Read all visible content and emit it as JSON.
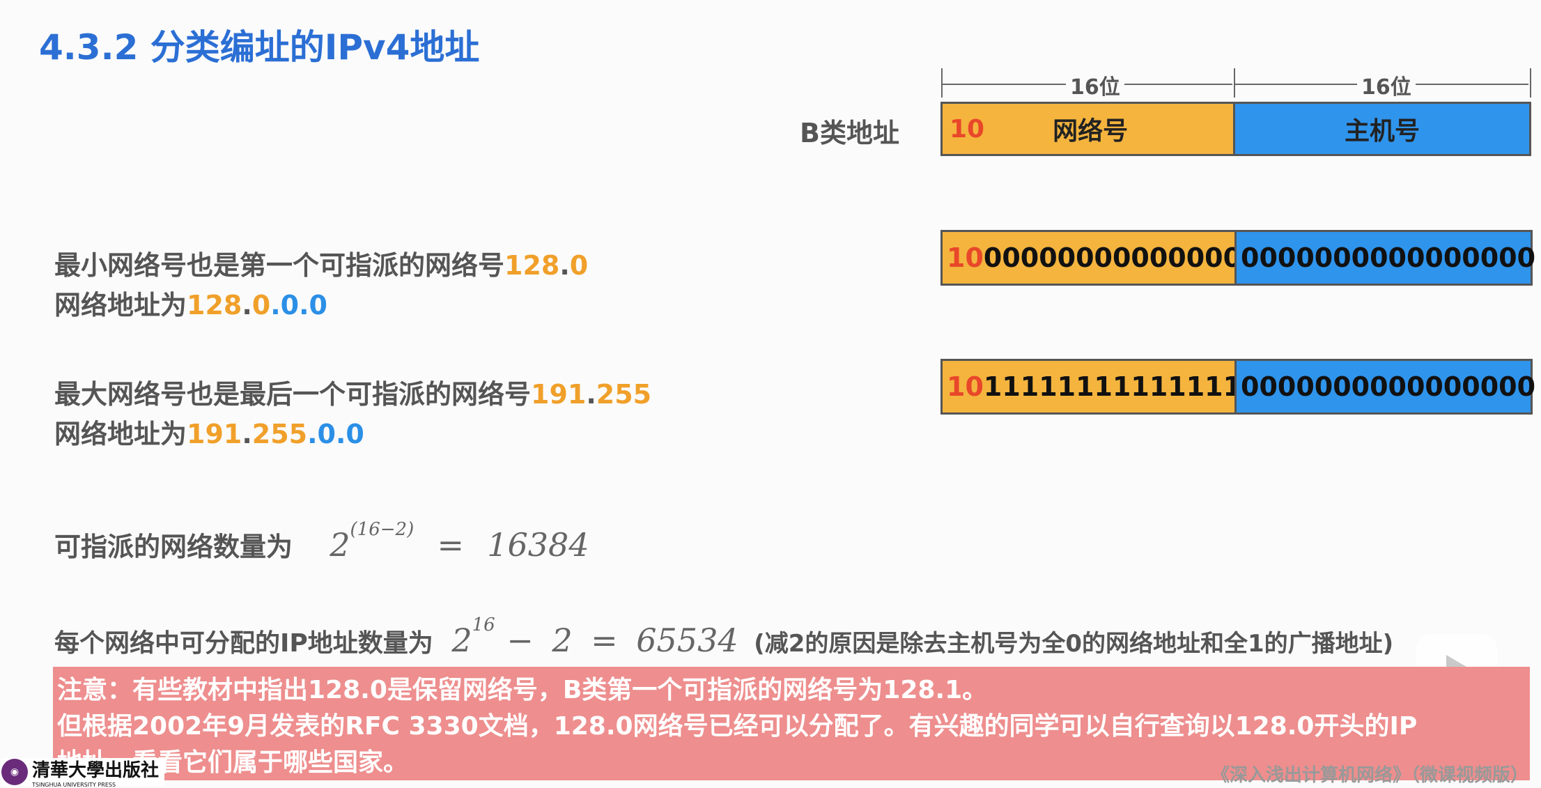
{
  "title": "4.3.2 分类编址的IPv4地址",
  "header": {
    "class_label": "B类地址",
    "bits_left": "16位",
    "bits_right": "16位",
    "prefix": "10",
    "network_label": "网络号",
    "host_label": "主机号"
  },
  "min_row": {
    "prefix": "10",
    "network_bits": "00000000000000",
    "host_bits": "0000000000000000",
    "line1_text": "最小网络号也是第一个可指派的网络号",
    "line1_a": "128",
    "line1_dot": ".",
    "line1_b": "0",
    "line2_text": "网络地址为",
    "line2_a": "128",
    "line2_dot1": ".",
    "line2_b": "0",
    "line2_c": ".0.0"
  },
  "max_row": {
    "prefix": "10",
    "network_bits": "11111111111111",
    "host_bits": "0000000000000000",
    "line1_text": "最大网络号也是最后一个可指派的网络号",
    "line1_a": "191",
    "line1_dot": ".",
    "line1_b": "255",
    "line2_text": "网络地址为",
    "line2_a": "191",
    "line2_dot1": ".",
    "line2_b": "255",
    "line2_c": ".0.0"
  },
  "networks": {
    "label": "可指派的网络数量为",
    "base": "2",
    "exponent": "(16−2)",
    "equals": "=",
    "result": "16384"
  },
  "hosts": {
    "label": "每个网络中可分配的IP地址数量为",
    "base": "2",
    "exponent": "16",
    "minus": "−",
    "two": "2",
    "equals": "=",
    "result": "65534",
    "note": "(减2的原因是除去主机号为全0的网络地址和全1的广播地址)"
  },
  "note": {
    "line1": "注意：有些教材中指出128.0是保留网络号，B类第一个可指派的网络号为128.1。",
    "line2": "但根据2002年9月发表的RFC 3330文档，128.0网络号已经可以分配了。有兴趣的同学可以自行查询以128.0开头的IP",
    "line3": "地址，看看它们属于哪些国家。"
  },
  "publisher": {
    "name": "清華大學出版社",
    "sub": "TSINGHUA UNIVERSITY PRESS"
  },
  "footer": "《深入浅出计算机网络》（微课视频版）",
  "colors": {
    "title_blue": "#2b6fd4",
    "network_orange": "#f4b43e",
    "host_blue": "#2f94ec",
    "prefix_red": "#e8472a",
    "note_bg": "#ee8e8e"
  }
}
